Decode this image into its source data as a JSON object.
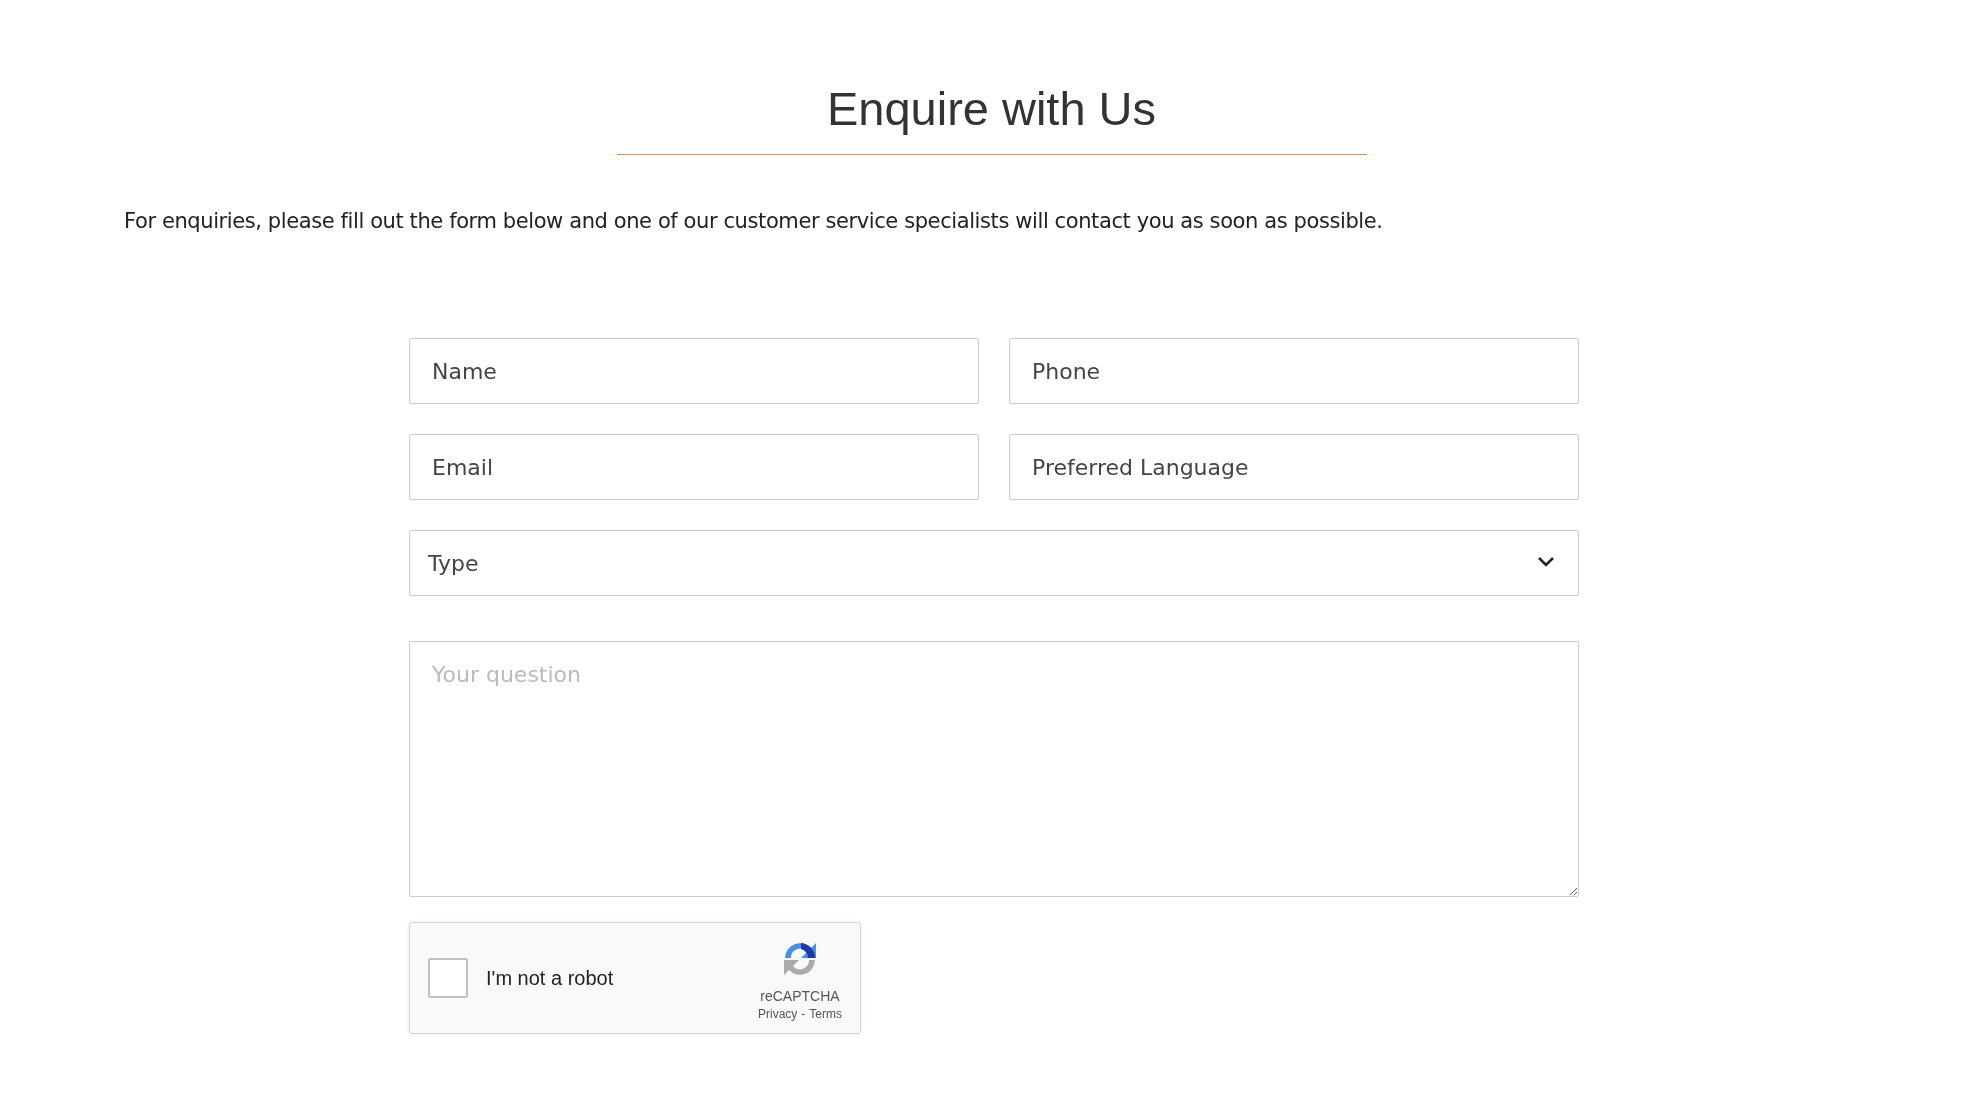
{
  "title": "Enquire with Us",
  "intro": "For enquiries, please fill out the form below and one of our customer service specialists will contact you as soon as possible.",
  "fields": [
    {
      "kind": "input",
      "placeholder": "Name"
    },
    {
      "kind": "input",
      "placeholder": "Phone"
    },
    {
      "kind": "input",
      "placeholder": "Email"
    },
    {
      "kind": "input",
      "placeholder": "Preferred Language"
    },
    {
      "kind": "select",
      "value": "Type"
    },
    {
      "kind": "textarea",
      "placeholder": "Your question"
    }
  ],
  "captcha": {
    "checked": false,
    "label": "I'm not a robot",
    "brand": "reCAPTCHA",
    "privacy": "Privacy",
    "separator": "-",
    "terms": "Terms"
  }
}
